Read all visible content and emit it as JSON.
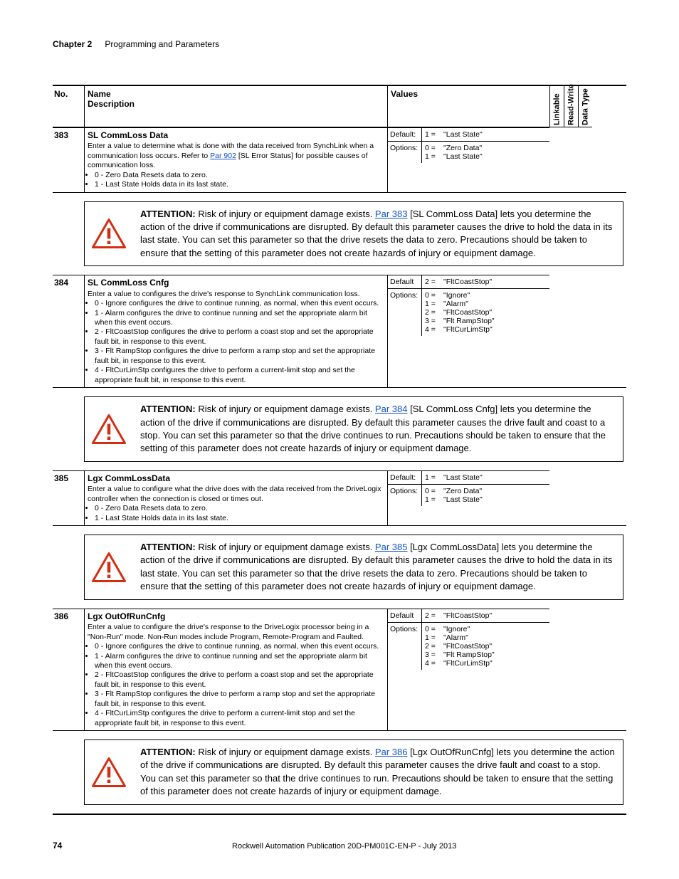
{
  "header": {
    "chapter": "Chapter 2",
    "title": "Programming and Parameters"
  },
  "columns": {
    "no": "No.",
    "name_line1": "Name",
    "name_line2": "Description",
    "values": "Values",
    "flag1": "Linkable",
    "flag2": "Read-Write",
    "flag3": "Data Type"
  },
  "rows": [
    {
      "no": "383",
      "name_bold": "SL CommLoss Data",
      "desc_pre": "Enter a value to determine what is done with the data received from SynchLink when a communication loss occurs. Refer to ",
      "desc_link": "Par 902",
      "desc_post": " [SL Error Status] for possible causes of communication loss.",
      "bullets": [
        "0 - Zero Data Resets data to zero.",
        "1 - Last State Holds data in its last state."
      ],
      "default_label": "Default:",
      "default_body": [
        {
          "k": "1 =",
          "v": "\"Last State\""
        }
      ],
      "options_label": "Options:",
      "options_body": [
        {
          "k": "0 =",
          "v": "\"Zero Data\""
        },
        {
          "k": "1 =",
          "v": "\"Last State\""
        }
      ],
      "attn_link": "Par 383",
      "attn_linklabel": "[SL CommLoss Data]",
      "attn_tail": " lets you determine the action of the drive if communications are disrupted. By default this parameter causes the drive to hold the data in its last state. You can set this parameter so that the drive resets the data to zero. Precautions should be taken to ensure that the setting of this parameter does not create hazards of injury or equipment damage."
    },
    {
      "no": "384",
      "name_bold": "SL CommLoss Cnfg",
      "desc_pre": "Enter a value to configures the drive's response to SynchLink communication loss.",
      "desc_link": "",
      "desc_post": "",
      "bullets": [
        "0 - Ignore configures the drive to continue running, as normal, when this event occurs.",
        "1 - Alarm configures the drive to continue running and set the appropriate alarm bit when this event occurs.",
        "2 - FltCoastStop configures the drive to perform a coast stop and set the appropriate fault bit, in response to this event.",
        "3 - Flt RampStop configures the drive to perform a ramp stop and set the appropriate fault bit, in response to this event.",
        "4 - FltCurLimStp configures the drive to perform a current-limit stop and set the appropriate fault bit, in response to this event."
      ],
      "default_label": "Default",
      "default_body": [
        {
          "k": "2 =",
          "v": "\"FltCoastStop\""
        }
      ],
      "options_label": "Options:",
      "options_body": [
        {
          "k": "0 =",
          "v": "\"Ignore\""
        },
        {
          "k": "1 =",
          "v": "\"Alarm\""
        },
        {
          "k": "2 =",
          "v": "\"FltCoastStop\""
        },
        {
          "k": "3 =",
          "v": "\"Flt RampStop\""
        },
        {
          "k": "4 =",
          "v": "\"FltCurLimStp\""
        }
      ],
      "attn_link": "Par 384",
      "attn_linklabel": "[SL CommLoss Cnfg]",
      "attn_tail": " lets you determine the action of the drive if communications are disrupted. By default this parameter causes the drive fault and coast to a stop. You can set this parameter so that the drive continues to run. Precautions should be taken to ensure that the setting of this parameter does not create hazards of injury or equipment damage."
    },
    {
      "no": "385",
      "name_bold": "Lgx CommLossData",
      "desc_pre": "Enter a value to configure what the drive does with the data received from the DriveLogix controller when the connection is closed or times out.",
      "desc_link": "",
      "desc_post": "",
      "bullets": [
        "0 - Zero Data Resets data to zero.",
        "1 - Last State Holds data in its last state."
      ],
      "default_label": "Default:",
      "default_body": [
        {
          "k": "1 =",
          "v": "\"Last State\""
        }
      ],
      "options_label": "Options:",
      "options_body": [
        {
          "k": "0 =",
          "v": "\"Zero Data\""
        },
        {
          "k": "1 =",
          "v": "\"Last State\""
        }
      ],
      "attn_link": "Par 385",
      "attn_linklabel": "[Lgx CommLossData]",
      "attn_tail": " lets you determine the action of the drive if communications are disrupted. By default this parameter causes the drive to hold the data in its last state. You can set this parameter so that the drive resets the data to zero. Precautions should be taken to ensure that the setting of this parameter does not create hazards of injury or equipment damage."
    },
    {
      "no": "386",
      "name_bold": "Lgx OutOfRunCnfg",
      "desc_pre": "Enter a value to configure the drive's response to the DriveLogix processor being in a \"Non-Run\" mode.  Non-Run modes include Program, Remote-Program and Faulted.",
      "desc_link": "",
      "desc_post": "",
      "bullets": [
        "0 - Ignore configures the drive to continue running, as normal, when this event occurs.",
        "1 - Alarm configures the drive to continue running and set the appropriate alarm bit when this event occurs.",
        "2 - FltCoastStop configures the drive to perform a coast stop and set the appropriate fault bit, in response to this event.",
        "3 - Flt RampStop configures the drive to perform a ramp stop and set the appropriate fault bit, in response to this event.",
        "4 - FltCurLimStp configures the drive to perform a current-limit stop and set the appropriate fault bit, in response to this event."
      ],
      "default_label": "Default",
      "default_body": [
        {
          "k": "2 =",
          "v": "\"FltCoastStop\""
        }
      ],
      "options_label": "Options:",
      "options_body": [
        {
          "k": "0 =",
          "v": "\"Ignore\""
        },
        {
          "k": "1 =",
          "v": "\"Alarm\""
        },
        {
          "k": "2 =",
          "v": "\"FltCoastStop\""
        },
        {
          "k": "3 =",
          "v": "\"Flt RampStop\""
        },
        {
          "k": "4 =",
          "v": "\"FltCurLimStp\""
        }
      ],
      "attn_link": "Par 386",
      "attn_linklabel": "[Lgx OutOfRunCnfg]",
      "attn_tail": " lets you determine the action of the drive if communications are disrupted. By default this parameter causes the drive fault and coast to a stop. You can set this parameter so that the drive continues to run. Precautions should be taken to ensure that the setting of this parameter does not create hazards of injury or equipment damage."
    }
  ],
  "attn_lead": "ATTENTION:",
  "attn_risk": " Risk of injury or equipment damage exists. ",
  "footer": {
    "page": "74",
    "pub": "Rockwell Automation Publication 20D-PM001C-EN-P - July 2013"
  }
}
